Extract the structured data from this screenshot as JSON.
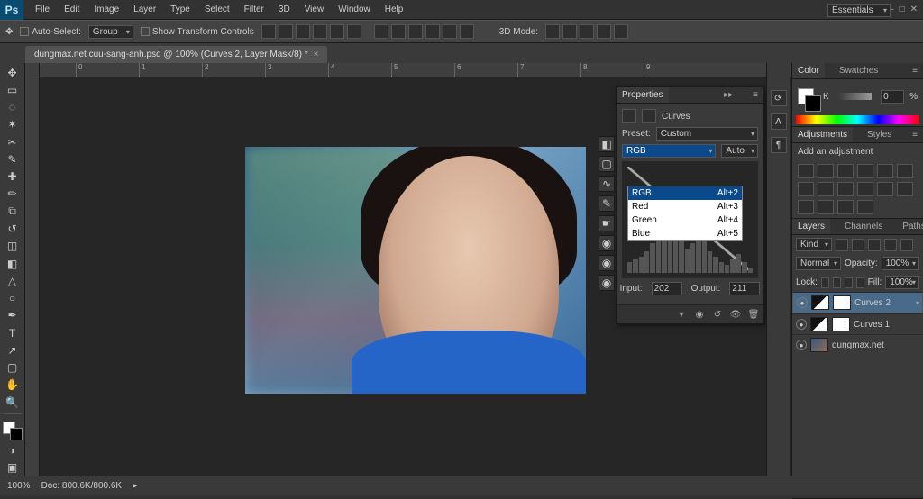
{
  "app": {
    "logo": "Ps"
  },
  "menu": [
    "File",
    "Edit",
    "Image",
    "Layer",
    "Type",
    "Select",
    "Filter",
    "3D",
    "View",
    "Window",
    "Help"
  ],
  "workspace_selector": "Essentials",
  "options": {
    "auto_select_label": "Auto-Select:",
    "auto_select_mode": "Group",
    "show_transform": "Show Transform Controls",
    "threeD": "3D Mode:"
  },
  "document": {
    "tab_label": "dungmax.net cuu-sang-anh.psd @ 100% (Curves 2, Layer Mask/8) *"
  },
  "ruler_marks": [
    0,
    1,
    2,
    3,
    4,
    5,
    6,
    7,
    8,
    9
  ],
  "properties": {
    "title": "Properties",
    "type": "Curves",
    "preset_label": "Preset:",
    "preset_value": "Custom",
    "channel_label": "RGB",
    "auto": "Auto",
    "dropdown": [
      {
        "name": "RGB",
        "key": "Alt+2",
        "hl": true
      },
      {
        "name": "Red",
        "key": "Alt+3",
        "hl": false
      },
      {
        "name": "Green",
        "key": "Alt+4",
        "hl": false
      },
      {
        "name": "Blue",
        "key": "Alt+5",
        "hl": false
      }
    ],
    "input_label": "Input:",
    "input_value": "202",
    "output_label": "Output:",
    "output_value": "211"
  },
  "color_panel": {
    "tabs": [
      "Color",
      "Swatches"
    ],
    "k_label": "K",
    "percent": "0",
    "unit": "%"
  },
  "adjustments_panel": {
    "tabs": [
      "Adjustments",
      "Styles"
    ],
    "title": "Add an adjustment"
  },
  "layers_panel": {
    "tabs": [
      "Layers",
      "Channels",
      "Paths"
    ],
    "kind_label": "Kind",
    "blend": "Normal",
    "opacity_label": "Opacity:",
    "opacity": "100%",
    "lock_label": "Lock:",
    "fill_label": "Fill:",
    "fill": "100%",
    "layers": [
      {
        "name": "Curves 2",
        "type": "adj",
        "selected": true
      },
      {
        "name": "Curves 1",
        "type": "adj",
        "selected": false
      },
      {
        "name": "dungmax.net",
        "type": "img",
        "selected": false
      }
    ]
  },
  "status": {
    "zoom": "100%",
    "doc_label": "Doc:",
    "doc": "800.6K/800.6K"
  }
}
